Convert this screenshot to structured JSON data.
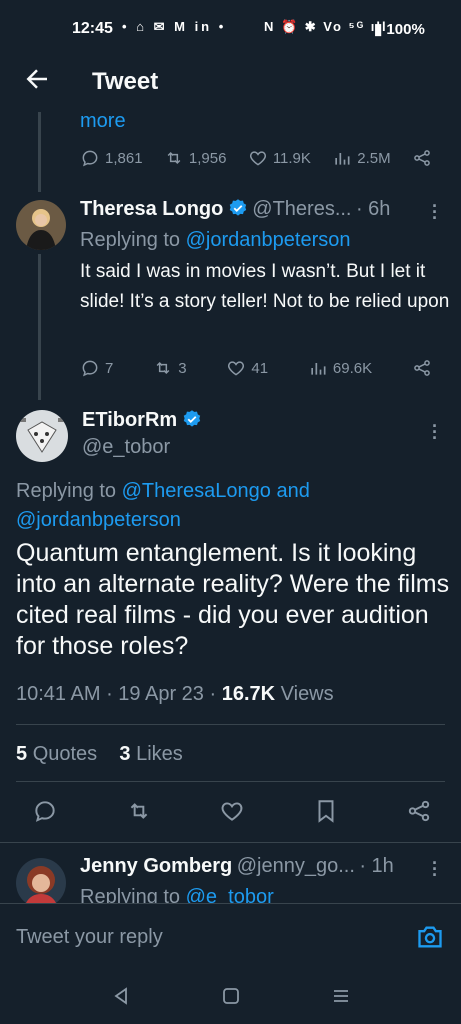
{
  "status_bar": {
    "time": "12:45",
    "left_icons": "• ⌂ ✉ M in •",
    "right_icons": "N ⏰ ✱ Vo ⁵ᴳ ıll",
    "battery": "100%"
  },
  "header": {
    "title": "Tweet"
  },
  "prev_tweet": {
    "more_label": "more",
    "replies": "1,861",
    "retweets": "1,956",
    "likes": "11.9K",
    "views": "2.5M"
  },
  "reply1": {
    "name": "Theresa Longo",
    "handle": "@Theres...",
    "time": "· 6h",
    "replying_prefix": "Replying to ",
    "replying_to": "@jordanbpeterson",
    "text": "It said I was in movies I wasn’t. But I let it slide! It’s a story teller! Not to be relied upon",
    "replies": "7",
    "retweets": "3",
    "likes": "41",
    "views": "69.6K"
  },
  "main_tweet": {
    "name": "ETiborRm",
    "handle": "@e_tobor",
    "replying_prefix": "Replying to ",
    "replying_to_1": "@TheresaLongo",
    "replying_and": " and",
    "replying_to_2": "@jordanbpeterson",
    "text": "Quantum entanglement. Is it looking into an alternate reality? Were the films cited real films - did you ever audition for those roles?",
    "time": "10:41 AM",
    "date": "19 Apr 23",
    "views_count": "16.7K",
    "views_label": "Views",
    "quotes_count": "5",
    "quotes_label": "Quotes",
    "likes_count": "3",
    "likes_label": "Likes"
  },
  "reply2": {
    "name": "Jenny Gomberg",
    "handle": "@jenny_go...",
    "time": "· 1h",
    "replying_prefix": "Replying to ",
    "replying_to": "@e_tobor"
  },
  "reply_box": {
    "placeholder": "Tweet your reply"
  },
  "colors": {
    "background": "#15202b",
    "accent": "#1d9bf0",
    "muted": "#8b98a5",
    "divider": "#38444d"
  }
}
